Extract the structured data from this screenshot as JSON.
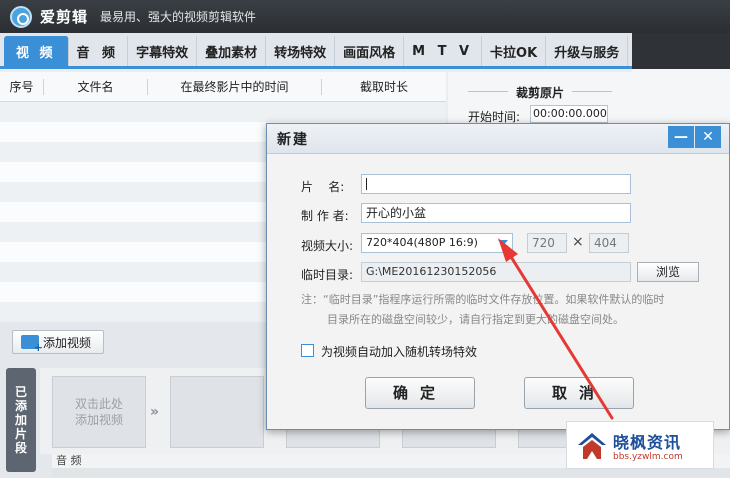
{
  "app": {
    "name": "爱剪辑",
    "slogan": "最易用、强大的视频剪辑软件"
  },
  "tabs": [
    {
      "label": "视 频",
      "active": true
    },
    {
      "label": "音 频"
    },
    {
      "label": "字幕特效"
    },
    {
      "label": "叠加素材"
    },
    {
      "label": "转场特效"
    },
    {
      "label": "画面风格"
    },
    {
      "label": "M T V"
    },
    {
      "label": "卡拉OK"
    },
    {
      "label": "升级与服务"
    }
  ],
  "list": {
    "columns": [
      "序号",
      "文件名",
      "在最终影片中的时间",
      "截取时长"
    ]
  },
  "crop": {
    "title": "裁剪原片",
    "start_label": "开始时间:",
    "start_value": "00:00:00.000"
  },
  "bottom": {
    "add_video_label": "添加视频",
    "side_label": [
      "已",
      "添",
      "加",
      "片",
      "段"
    ],
    "placeholder_line1": "双击此处",
    "placeholder_line2": "添加视频",
    "audio_label": "音 频"
  },
  "dialog": {
    "title": "新建",
    "name_label": "片    名:",
    "name_value": "",
    "author_label": "制 作 者:",
    "author_value": "开心的小盆",
    "size_label": "视频大小:",
    "size_value": "720*404(480P 16:9)",
    "width_value": "720",
    "height_value": "404",
    "times": "×",
    "temp_label": "临时目录:",
    "temp_value": "G:\\ME20161230152056",
    "browse_label": "浏览",
    "note_line1": "注：“临时目录”指程序运行所需的临时文件存放位置。如果软件默认的临时",
    "note_line2": "目录所在的磁盘空间较少，请自行指定到更大的磁盘空间处。",
    "checkbox_label": "为视频自动加入随机转场特效",
    "checkbox_checked": false,
    "ok_label": "确定",
    "cancel_label": "取消",
    "minimize_glyph": "—",
    "close_glyph": "✕"
  },
  "watermark": {
    "text": "晓枫资讯",
    "url": "bbs.yzwlm.com"
  },
  "colors": {
    "accent": "#3b8fd6",
    "annotation_arrow": "#e53935"
  }
}
